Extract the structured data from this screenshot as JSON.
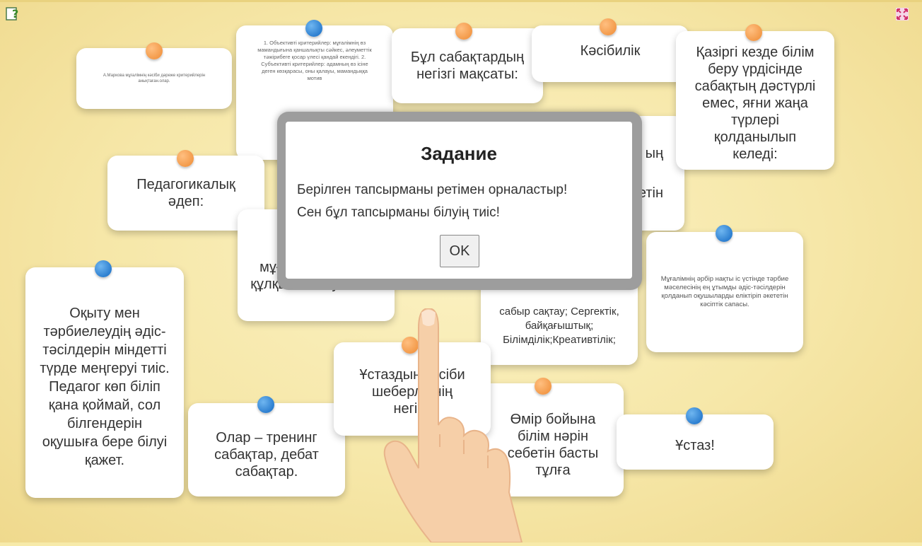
{
  "cards": {
    "c1": "А.Маркова мұғалімнің кәсіби дәреже критерийлерін анықтаған.олар.",
    "c2": "1. Объективті критерийлер: мұғалімнің өз мамандығына қаншалықты сәйкес, әлеуметтік тәжірибеге қосар үлесі қандай екендігі. 2. Субъективті критерийлер: адамның өз ісіне деген көзқарасы, оны қалауы, мамандыққа мотив",
    "c3": "Бұл сабақтардың негізгі мақсаты:",
    "c4": "Кәсібилік",
    "c5": "Қазіргі кезде білім беру үрдісінде сабақтың дәстүрлі емес, яғни жаңа түрлері қолданылып келеді:",
    "c6": "Педагогикалық әдеп:",
    "c7a": "ың",
    "c7b": "етін",
    "c8": "мұғалімнің мінез-құлқы ... болуы тиіс.",
    "c9": "Мұғалімнің әрбір нақты іс үстінде тәрбие мәселесінің ең ұтымды әдіс-тәсілдерін қолданып оқушыларды еліктіріп әкететін кәсіптік сапасы.",
    "c10": "Оқыту мен тәрбиелеудің әдіс-тәсілдерін міндетті түрде меңгеруі тиіс. Педагог көп біліп қана қоймай, сол білгендерін оқушыға бере білуі қажет.",
    "c11": "сабыр сақтау; Сергектік, байқағыштық; Білімділік;Креативтілік;",
    "c12": "Ұстаздың кәсіби шеберлігінің негізі:",
    "c13": "Олар – тренинг сабақтар, дебат сабақтар.",
    "c14": "Өмір бойына білім нәрін себетін басты тұлға",
    "c15": "Ұстаз!"
  },
  "modal": {
    "title": "Задание",
    "line1": "Берілген тапсырманы ретімен орналастыр!",
    "line2": "Сен бұл тапсырманы білуің тиіс!",
    "ok": "OK"
  },
  "icons": {
    "help": "help-icon",
    "fullscreen": "fullscreen-icon",
    "hand": "pointing-hand-icon"
  }
}
